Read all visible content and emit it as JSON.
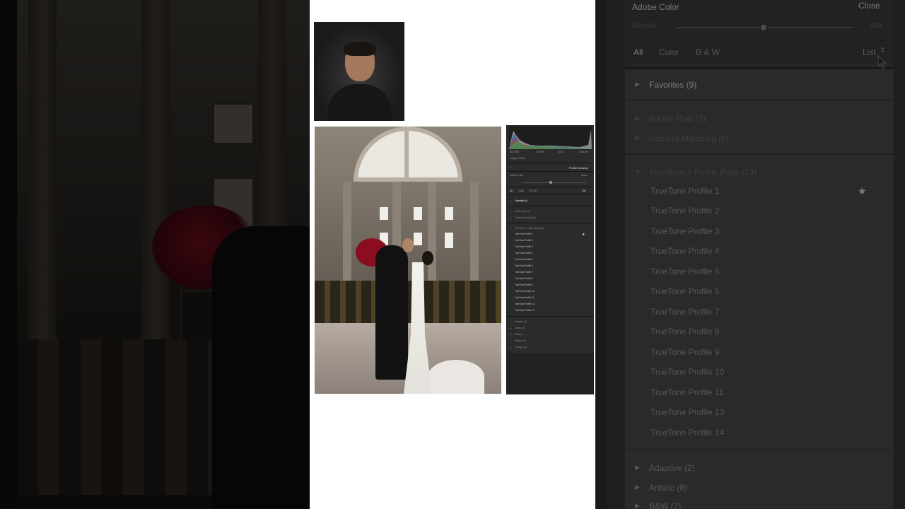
{
  "panel": {
    "profile_name": "Adobe Color",
    "close_label": "Close",
    "amount_label": "Amount",
    "amount_value": "100",
    "tabs": [
      "All",
      "Color",
      "B & W"
    ],
    "view_label": "List",
    "groups": [
      {
        "label": "Favorites (9)"
      },
      {
        "label": "Adobe Raw (7)"
      },
      {
        "label": "Camera Matching (6)"
      },
      {
        "label": "TrueTone // Profile Pack (13)"
      }
    ],
    "profiles": [
      "TrueTone Profile 1",
      "TrueTone Profile 2",
      "TrueTone Profile 3",
      "TrueTone Profile 4",
      "TrueTone Profile 5",
      "TrueTone Profile 6",
      "TrueTone Profile 7",
      "TrueTone Profile 8",
      "TrueTone Profile 9",
      "TrueTone Profile 10",
      "TrueTone Profile 11",
      "TrueTone Profile 13",
      "TrueTone Profile 14"
    ],
    "more_groups": [
      "Adaptive (2)",
      "Artistic (8)",
      "B&W (7)"
    ]
  },
  "mini": {
    "histogram_info": [
      "ISO 800",
      "35 mm",
      "f/1.8",
      "1/60 sec"
    ],
    "original_photo": "Original Photo",
    "browser_title": "Profile Browser",
    "profile_name": "Adobe Color",
    "close_label": "Close",
    "tabs": [
      "All",
      "Color",
      "B & W"
    ],
    "view_label": "List",
    "favorites": "Favorites (9)",
    "groups": [
      "Adobe Raw (7)",
      "Camera Matching (6)"
    ],
    "pack": "TrueTone // Profile Pack (13)",
    "profiles": [
      "TrueTone Profile 1",
      "TrueTone Profile 2",
      "TrueTone Profile 3",
      "TrueTone Profile 4",
      "TrueTone Profile 5",
      "TrueTone Profile 6",
      "TrueTone Profile 7",
      "TrueTone Profile 8",
      "TrueTone Profile 9",
      "TrueTone Profile 10",
      "TrueTone Profile 11",
      "TrueTone Profile 13",
      "TrueTone Profile 14"
    ],
    "more_groups": [
      "Adaptive (2)",
      "Artistic (8)",
      "B&W (7)",
      "Modern (3)",
      "Vintage (11)"
    ]
  },
  "colors": {
    "panel_bg": "#2a2a2a",
    "text": "#575757",
    "page_bg": "#ffffff"
  }
}
